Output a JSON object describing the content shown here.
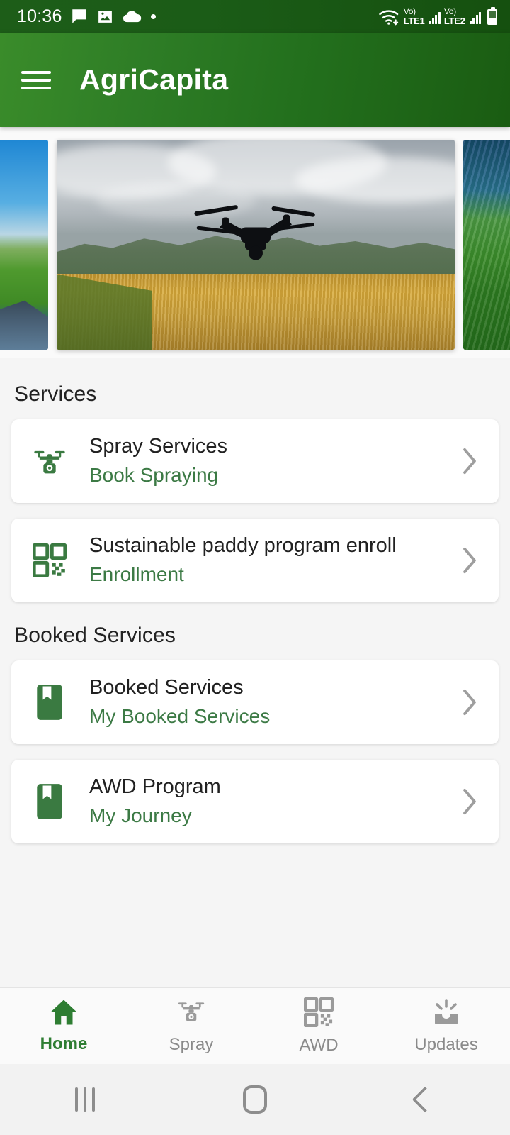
{
  "status_bar": {
    "time": "10:36",
    "left_icons": [
      "message-icon",
      "image-icon",
      "cloud-icon",
      "dot-icon"
    ],
    "wifi_icon": "wifi-icon",
    "sim1_volte": "Vo)",
    "sim1_network": "LTE1",
    "sim2_volte": "Vo)",
    "sim2_network": "LTE2",
    "battery_icon": "battery-icon"
  },
  "app_bar": {
    "menu_icon": "hamburger-menu-icon",
    "title": "AgriCapita",
    "gradient_from": "#3a8c2a",
    "gradient_to": "#1a5c12"
  },
  "carousel": {
    "slides": [
      {
        "name": "farmer-field-slide",
        "alt": "Farmer in green terraced paddy field under blue sky"
      },
      {
        "name": "drone-wheat-slide",
        "alt": "Agricultural drone flying over golden wheat field with hills"
      },
      {
        "name": "drone-spraying-slide",
        "alt": "Drone spraying green crop plantation"
      }
    ],
    "active_index": 1
  },
  "main": {
    "sections": [
      {
        "title": "Services",
        "cards": [
          {
            "icon": "drone-icon",
            "title": "Spray Services",
            "subtitle": "Book Spraying",
            "chevron": "chevron-right-icon"
          },
          {
            "icon": "qr-code-icon",
            "title": "Sustainable paddy program enroll",
            "subtitle": "Enrollment",
            "chevron": "chevron-right-icon"
          }
        ]
      },
      {
        "title": "Booked Services",
        "cards": [
          {
            "icon": "bookmark-icon",
            "title": "Booked Services",
            "subtitle": "My Booked Services",
            "chevron": "chevron-right-icon"
          },
          {
            "icon": "bookmark-icon",
            "title": "AWD Program",
            "subtitle": "My Journey",
            "chevron": "chevron-right-icon"
          }
        ]
      }
    ]
  },
  "bottom_nav": {
    "active": "Home",
    "items": [
      {
        "label": "Home",
        "icon": "home-icon",
        "active": true
      },
      {
        "label": "Spray",
        "icon": "drone-icon",
        "active": false
      },
      {
        "label": "AWD",
        "icon": "qr-code-icon",
        "active": false
      },
      {
        "label": "Updates",
        "icon": "campaign-icon",
        "active": false
      }
    ]
  },
  "system_nav": {
    "recents": "recents-icon",
    "home": "home-square-icon",
    "back": "back-chevron-icon"
  },
  "colors": {
    "primary_green": "#2e7d32",
    "dark_green": "#1a5c12",
    "subtitle_green": "#3c7a45",
    "page_background": "#f5f5f5",
    "card_background": "#ffffff",
    "chevron_grey": "#9e9e9e"
  }
}
